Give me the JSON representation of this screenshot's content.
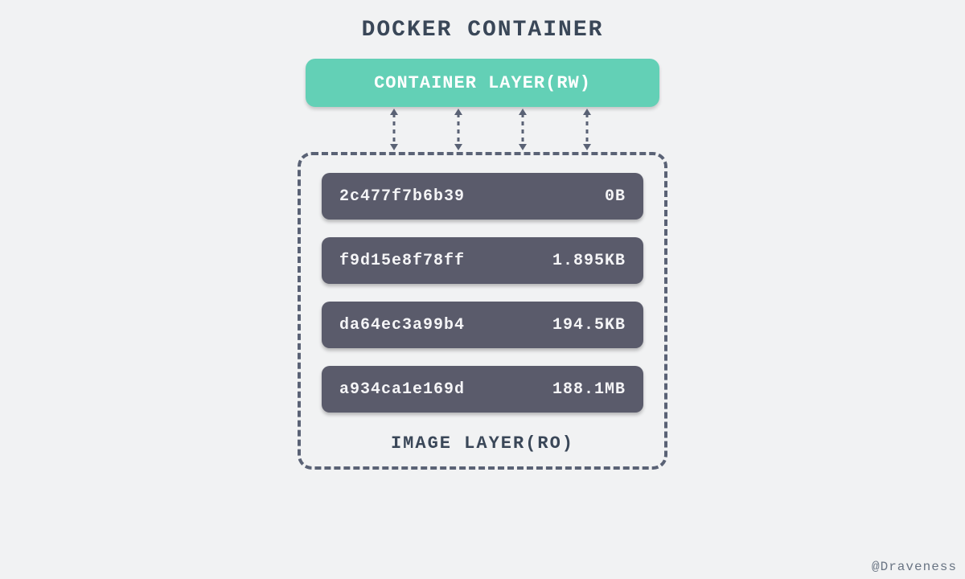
{
  "title": "DOCKER CONTAINER",
  "container_layer_label": "CONTAINER LAYER(RW)",
  "image_layer_label": "IMAGE LAYER(RO)",
  "layers": [
    {
      "hash": "2c477f7b6b39",
      "size": "0B"
    },
    {
      "hash": "f9d15e8f78ff",
      "size": "1.895KB"
    },
    {
      "hash": "da64ec3a99b4",
      "size": "194.5KB"
    },
    {
      "hash": "a934ca1e169d",
      "size": "188.1MB"
    }
  ],
  "attribution": "@Draveness",
  "colors": {
    "container_layer_bg": "#63d0b6",
    "image_layer_bg": "#5a5b6b",
    "border": "#5a6275",
    "text_dark": "#3a4758"
  }
}
